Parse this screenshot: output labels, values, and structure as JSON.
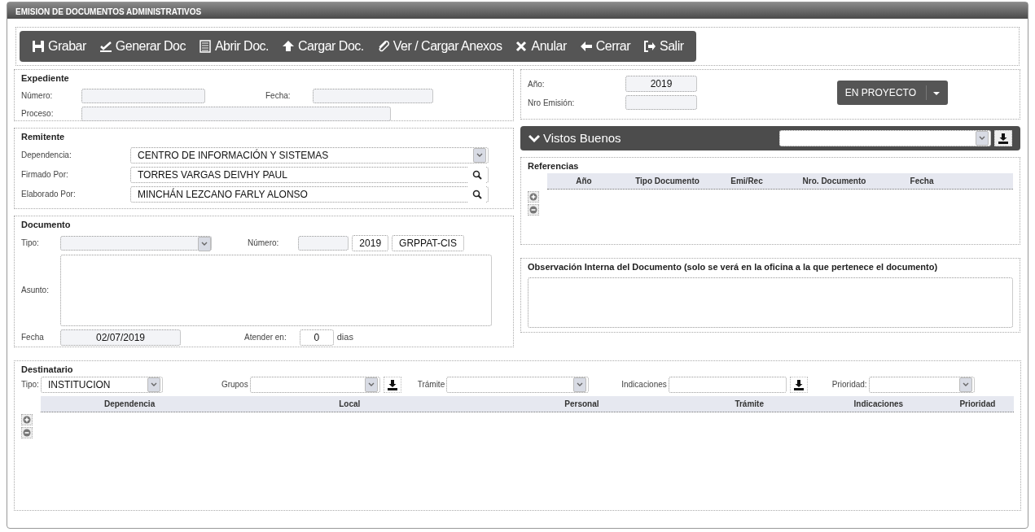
{
  "window": {
    "title": "EMISION DE DOCUMENTOS ADMINISTRATIVOS"
  },
  "toolbar": [
    {
      "label": "Grabar",
      "kind": "save"
    },
    {
      "label": "Generar Doc",
      "kind": "sign"
    },
    {
      "label": "Abrir Doc.",
      "kind": "list"
    },
    {
      "label": "Cargar Doc.",
      "kind": "upload"
    },
    {
      "label": "Ver / Cargar Anexos",
      "kind": "clip"
    },
    {
      "label": "Anular",
      "kind": "cross"
    },
    {
      "label": "Cerrar",
      "kind": "back"
    },
    {
      "label": "Salir",
      "kind": "exit"
    }
  ],
  "expediente": {
    "legend": "Expediente",
    "numero_label": "Número:",
    "fecha_label": "Fecha:",
    "proceso_label": "Proceso:"
  },
  "emision": {
    "anio_label": "Año:",
    "anio": "2019",
    "nro_label": "Nro Emisión:",
    "status_button": "EN PROYECTO"
  },
  "remitente": {
    "legend": "Remitente",
    "fields": [
      {
        "label": "Dependencia:",
        "value": "CENTRO DE INFORMACIÓN Y SISTEMAS",
        "kind": "select"
      },
      {
        "label": "Firmado Por:",
        "value": "TORRES VARGAS DEIVHY PAUL",
        "kind": "search"
      },
      {
        "label": "Elaborado Por:",
        "value": "MINCHÁN LEZCANO FARLY ALONSO",
        "kind": "search"
      }
    ]
  },
  "documento": {
    "legend": "Documento",
    "tipo_label": "Tipo:",
    "numero_label": "Número:",
    "numero_year": "2019",
    "numero_suffix": "GRPPAT-CIS",
    "asunto_label": "Asunto:",
    "fecha_label": "Fecha",
    "fecha": "02/07/2019",
    "atender_label": "Atender en:",
    "atender": "0",
    "dias": "dias"
  },
  "vistos_buenos": {
    "title": "Vistos Buenos"
  },
  "referencias": {
    "legend": "Referencias",
    "columns": [
      "Año",
      "Tipo Documento",
      "Emi/Rec",
      "Nro. Documento",
      "Fecha"
    ]
  },
  "observacion": {
    "legend": "Observación Interna del Documento (solo se verá en la oficina a la que pertenece el documento)"
  },
  "destinatario": {
    "legend": "Destinatario",
    "filters": [
      {
        "label": "Tipo:",
        "value": "INSTITUCION",
        "kind": "select"
      },
      {
        "label": "Grupos",
        "kind": "select_add"
      },
      {
        "label": "Trámite",
        "kind": "select"
      },
      {
        "label": "Indicaciones",
        "kind": "text_add"
      },
      {
        "label": "Prioridad:",
        "kind": "select"
      }
    ],
    "columns": [
      "Dependencia",
      "Local",
      "Personal",
      "Trámite",
      "Indicaciones",
      "Prioridad"
    ]
  }
}
